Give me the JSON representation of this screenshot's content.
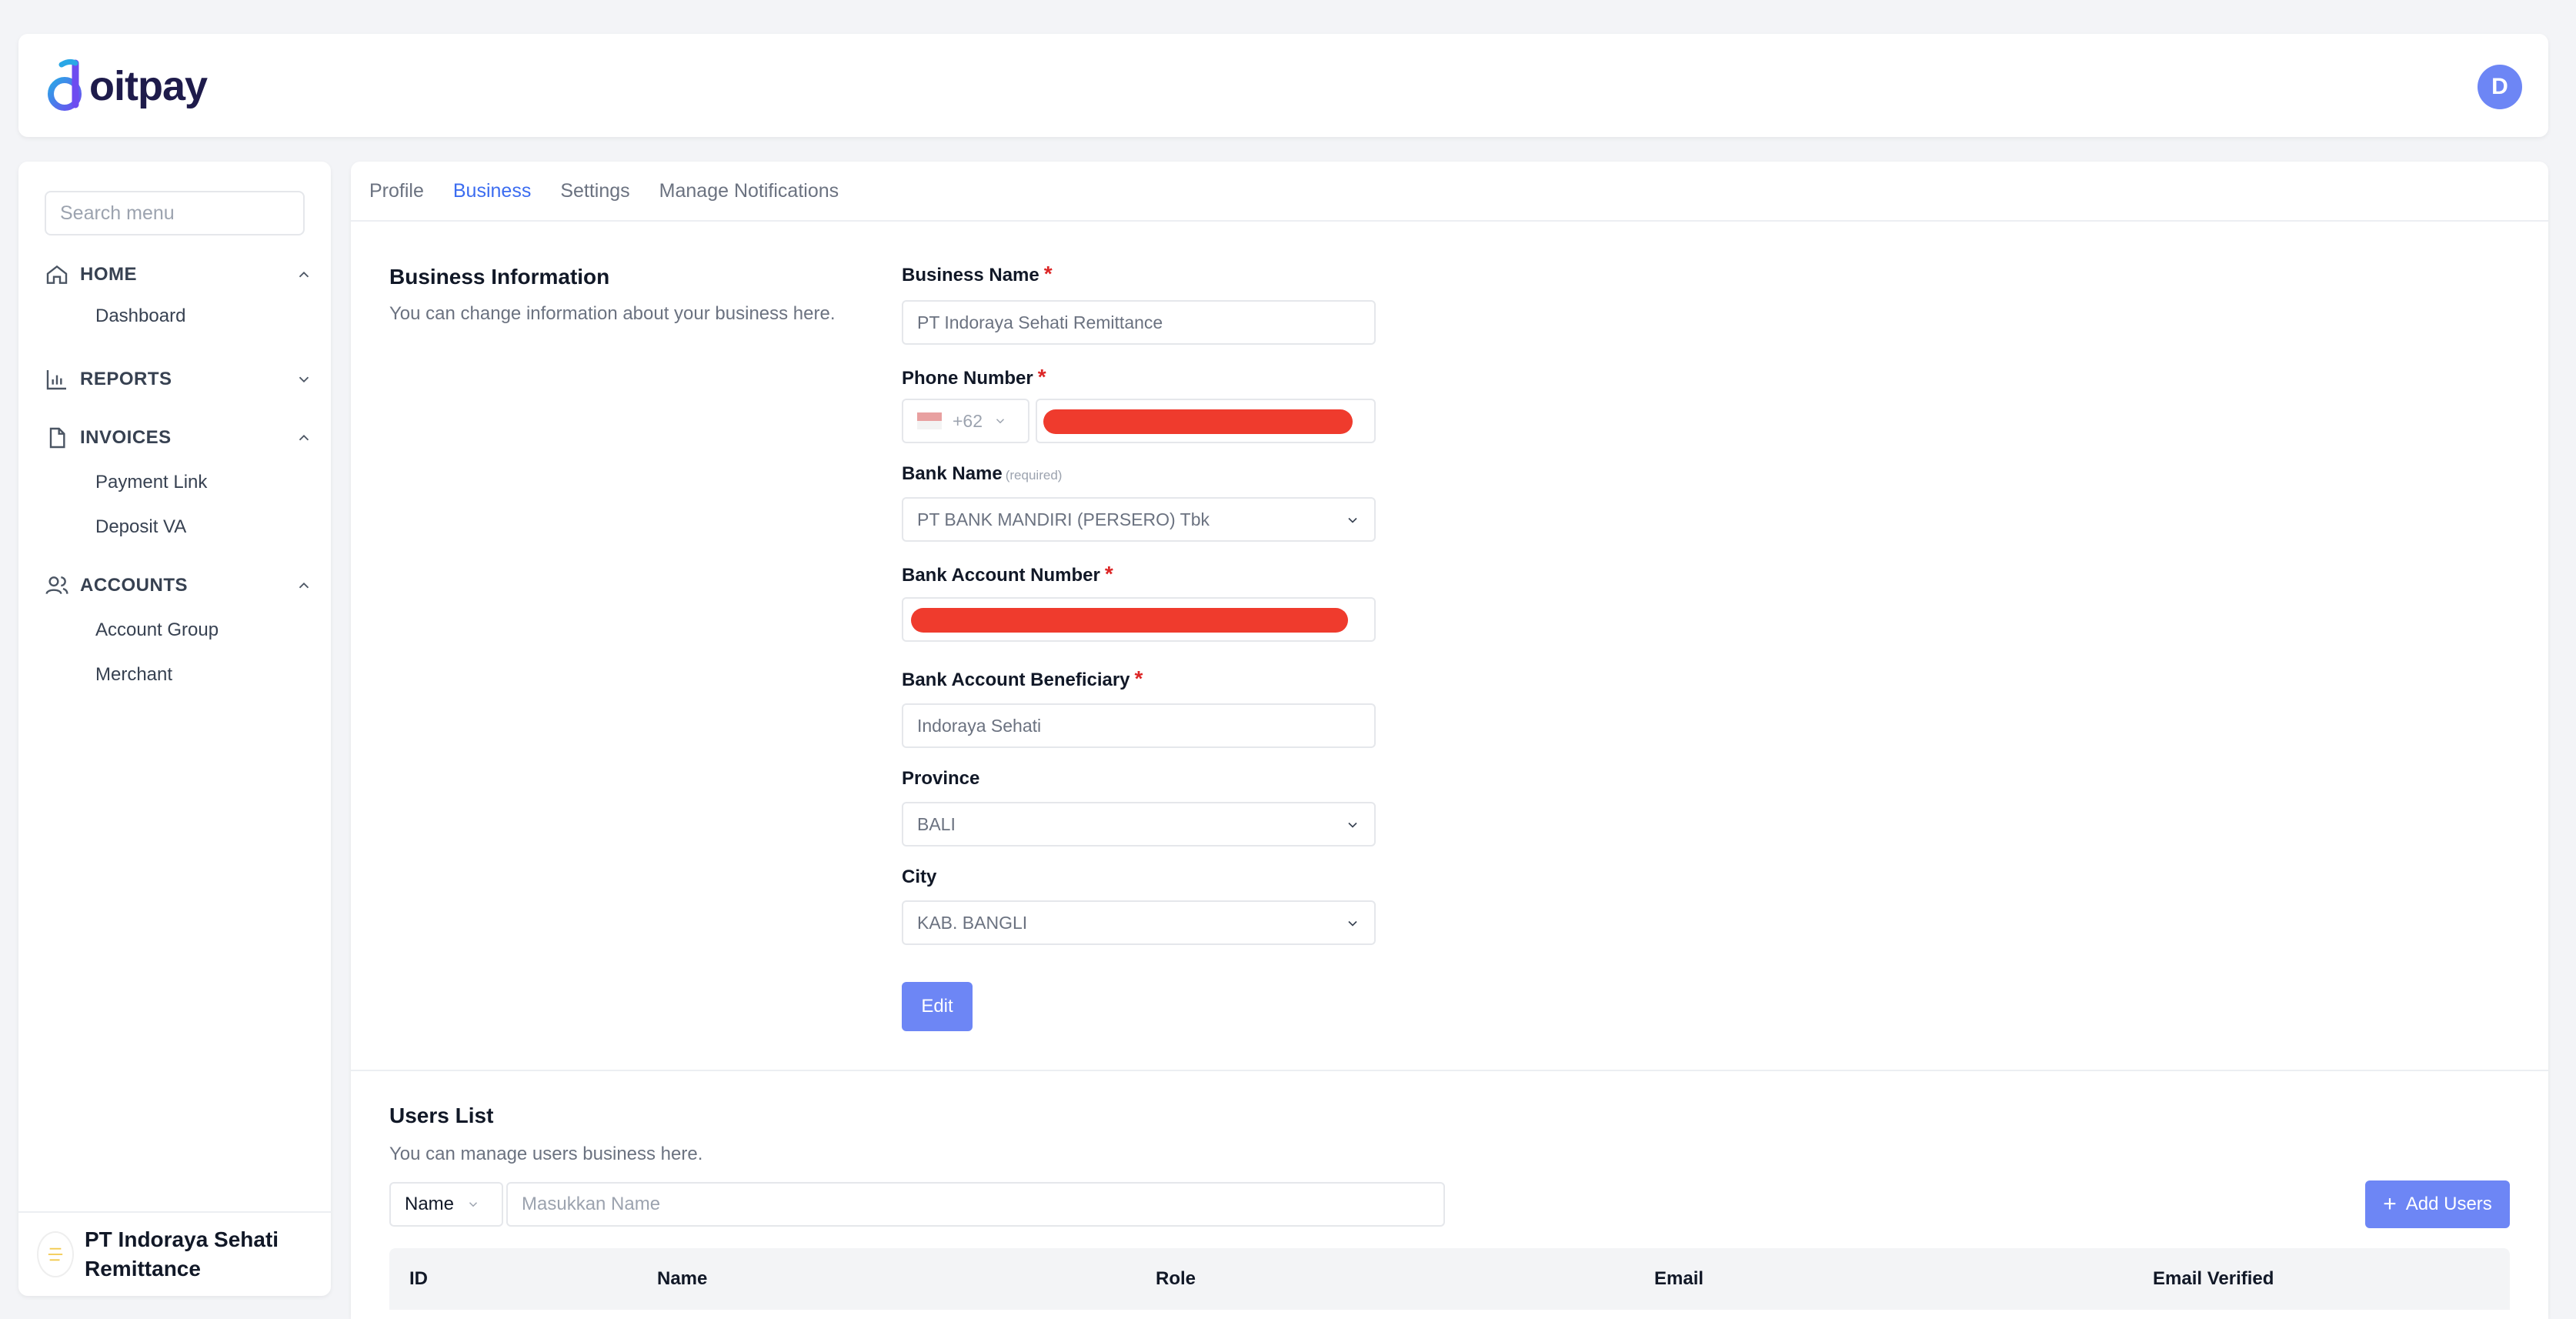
{
  "brand": {
    "logo_text": "oitpay",
    "accent": "#6d86f5"
  },
  "header": {
    "avatar_initial": "D"
  },
  "sidebar": {
    "search_placeholder": "Search menu",
    "groups": [
      {
        "label": "HOME",
        "icon": "home-icon",
        "expanded": true,
        "items": [
          "Dashboard"
        ]
      },
      {
        "label": "REPORTS",
        "icon": "bar-chart-icon",
        "expanded": false,
        "items": []
      },
      {
        "label": "INVOICES",
        "icon": "document-icon",
        "expanded": true,
        "items": [
          "Payment Link",
          "Deposit VA"
        ]
      },
      {
        "label": "ACCOUNTS",
        "icon": "users-icon",
        "expanded": true,
        "items": [
          "Account Group",
          "Merchant"
        ]
      }
    ],
    "company_name": "PT Indoraya Sehati Remittance"
  },
  "tabs": [
    {
      "label": "Profile",
      "active": false
    },
    {
      "label": "Business",
      "active": true
    },
    {
      "label": "Settings",
      "active": false
    },
    {
      "label": "Manage Notifications",
      "active": false
    }
  ],
  "business_info": {
    "title": "Business Information",
    "description": "You can change information about your business here.",
    "fields": {
      "business_name": {
        "label": "Business Name",
        "value": "PT Indoraya Sehati Remittance"
      },
      "phone": {
        "label": "Phone Number",
        "code": "+62"
      },
      "bank_name": {
        "label": "Bank Name",
        "note": "(required)",
        "value": "PT BANK MANDIRI (PERSERO) Tbk"
      },
      "bank_account_number": {
        "label": "Bank Account Number"
      },
      "beneficiary": {
        "label": "Bank Account Beneficiary",
        "value": "Indoraya Sehati"
      },
      "province": {
        "label": "Province",
        "value": "BALI"
      },
      "city": {
        "label": "City",
        "value": "KAB. BANGLI"
      }
    },
    "required_mark": "*",
    "edit_label": "Edit"
  },
  "users_list": {
    "title": "Users List",
    "description": "You can manage users business here.",
    "filter_field": "Name",
    "filter_placeholder": "Masukkan Name",
    "add_label": "Add Users",
    "columns": [
      "ID",
      "Name",
      "Role",
      "Email",
      "Email Verified"
    ]
  }
}
